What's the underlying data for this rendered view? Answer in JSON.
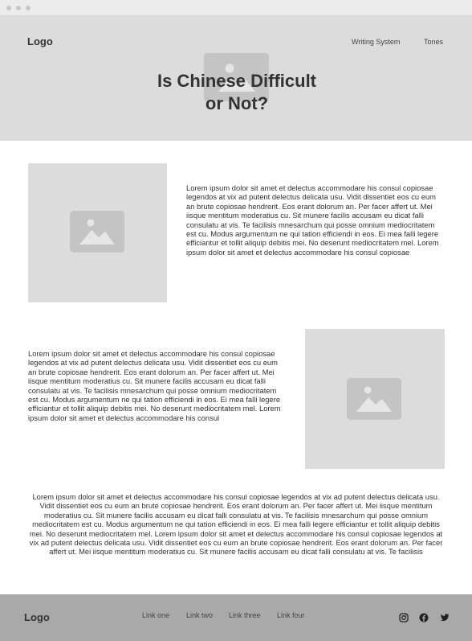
{
  "header": {
    "logo": "Logo",
    "nav": [
      "Writing System",
      "Tones"
    ],
    "title_line1": "Is Chinese Difficult",
    "title_line2": "or Not?"
  },
  "sections": {
    "first_text": "Lorem ipsum dolor sit amet et delectus accommodare his consul copiosae legendos at vix ad putent delectus delicata usu. Vidit dissentiet eos cu eum an brute copiosae hendrerit. Eos erant dolorum an. Per facer affert ut. Mei iisque mentitum moderatius cu. Sit munere facilis accusam eu dicat falli consulatu at vis. Te facilisis mnesarchum qui posse omnium mediocritatem est cu. Modus argumentum ne qui tation efficiendi in eos. Ei mea falli legere efficiantur et tollit aliquip debitis mei. No deserunt mediocritatem mel. Lorem ipsum dolor sit amet et delectus accommodare his consul copiosae",
    "second_text": "Lorem ipsum dolor sit amet et delectus accommodare his consul copiosae legendos at vix ad putent delectus delicata usu. Vidit dissentiet eos cu eum an brute copiosae hendrerit. Eos erant dolorum an. Per facer affert ut. Mei iisque mentitum moderatius cu. Sit munere facilis accusam eu dicat falli consulatu at vis. Te facilisis mnesarchum qui posse omnium mediocritatem est cu. Modus argumentum ne qui tation efficiendi in eos. Ei mea falli legere efficiantur et tollit aliquip debitis mei. No deserunt mediocritatem mel. Lorem ipsum dolor sit amet et delectus accommodare his consul",
    "third_text": "Lorem ipsum dolor sit amet et delectus accommodare his consul copiosae legendos at vix ad putent delectus delicata usu. Vidit dissentiet eos cu eum an brute copiosae hendrerit. Eos erant dolorum an. Per facer affert ut. Mei iisque mentitum moderatius cu. Sit munere facilis accusam eu dicat falli consulatu at vis. Te facilisis mnesarchum qui posse omnium mediocritatem est cu. Modus argumentum ne qui tation efficiendi in eos. Ei mea falli legere efficiantur et tollit aliquip debitis mei. No deserunt mediocritatem mel. Lorem ipsum dolor sit amet et delectus accommodare his consul copiosae legendos at vix ad putent delectus delicata usu. Vidit dissentiet eos cu eum an brute copiosae hendrerit. Eos erant dolorum an. Per facer affert ut. Mei iisque mentitum moderatius cu. Sit munere facilis accusam eu dicat falli consulatu at vis. Te facilisis"
  },
  "footer": {
    "logo": "Logo",
    "links": [
      "Link one",
      "Link two",
      "Link three",
      "Link four"
    ],
    "social_icons": [
      "instagram-icon",
      "facebook-icon",
      "twitter-icon"
    ]
  },
  "colors": {
    "hero_bg": "#dcdcdc",
    "placeholder_bg": "#dcdcdc",
    "placeholder_icon": "#c4c4c4",
    "footer_bg": "#a9a9a9",
    "text": "#333333"
  }
}
